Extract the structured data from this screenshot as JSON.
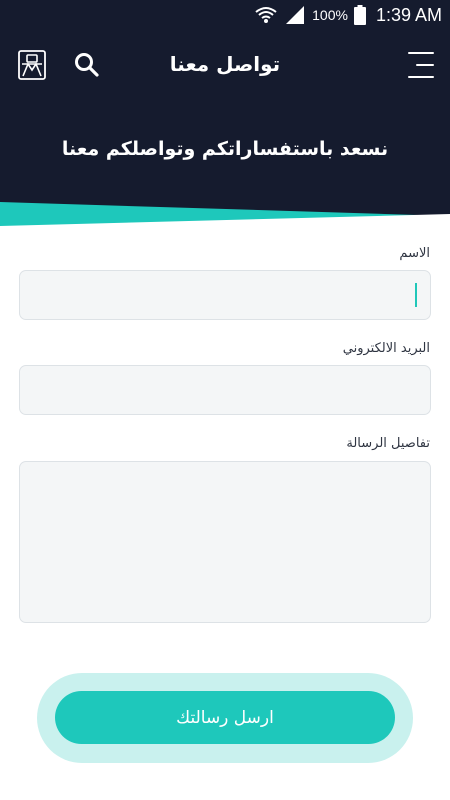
{
  "status_bar": {
    "battery_percent": "100%",
    "time": "1:39 AM",
    "icons": [
      "wifi-icon",
      "signal-icon",
      "battery-icon"
    ]
  },
  "header": {
    "title": "تواصل معنا",
    "subtitle": "نسعد باستفساراتكم وتواصلكم معنا",
    "icons": [
      "menu-icon",
      "search-icon",
      "app-logo-icon"
    ]
  },
  "form": {
    "name_label": "الاسم",
    "name_value": "",
    "email_label": "البريد الالكتروني",
    "email_value": "",
    "message_label": "تفاصيل الرسالة",
    "message_value": ""
  },
  "submit": {
    "label": "ارسل رسالتك"
  },
  "colors": {
    "header_bg": "#151b2e",
    "accent": "#1ec8bb",
    "accent_light": "#c9f1ee",
    "input_bg": "#f4f6f7"
  }
}
